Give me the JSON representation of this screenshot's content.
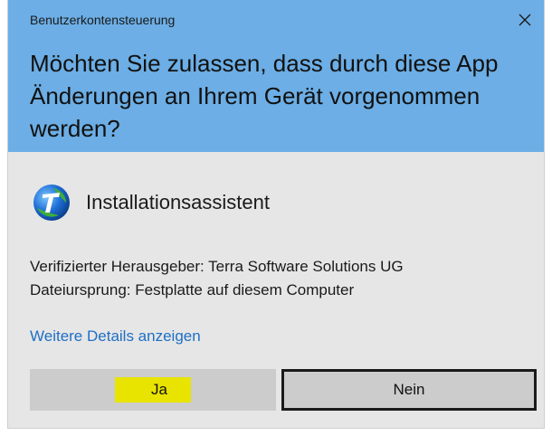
{
  "dialog": {
    "window_title": "Benutzerkontensteuerung",
    "question": "Möchten Sie zulassen, dass durch diese App Änderungen an Ihrem Gerät vorgenommen werden?",
    "app_name": "Installationsassistent",
    "publisher_line": "Verifizierter Herausgeber: Terra Software Solutions UG",
    "origin_line": "Dateiursprung: Festplatte auf diesem Computer",
    "details_link": "Weitere Details anzeigen",
    "yes_label": "Ja",
    "no_label": "Nein"
  },
  "icons": {
    "close": "close-icon",
    "app": "app-icon"
  },
  "colors": {
    "header_bg": "#6caee5",
    "body_bg": "#e6e6e6",
    "link": "#1e6fc6",
    "button_bg": "#cccccc",
    "highlight": "#e8e400"
  }
}
